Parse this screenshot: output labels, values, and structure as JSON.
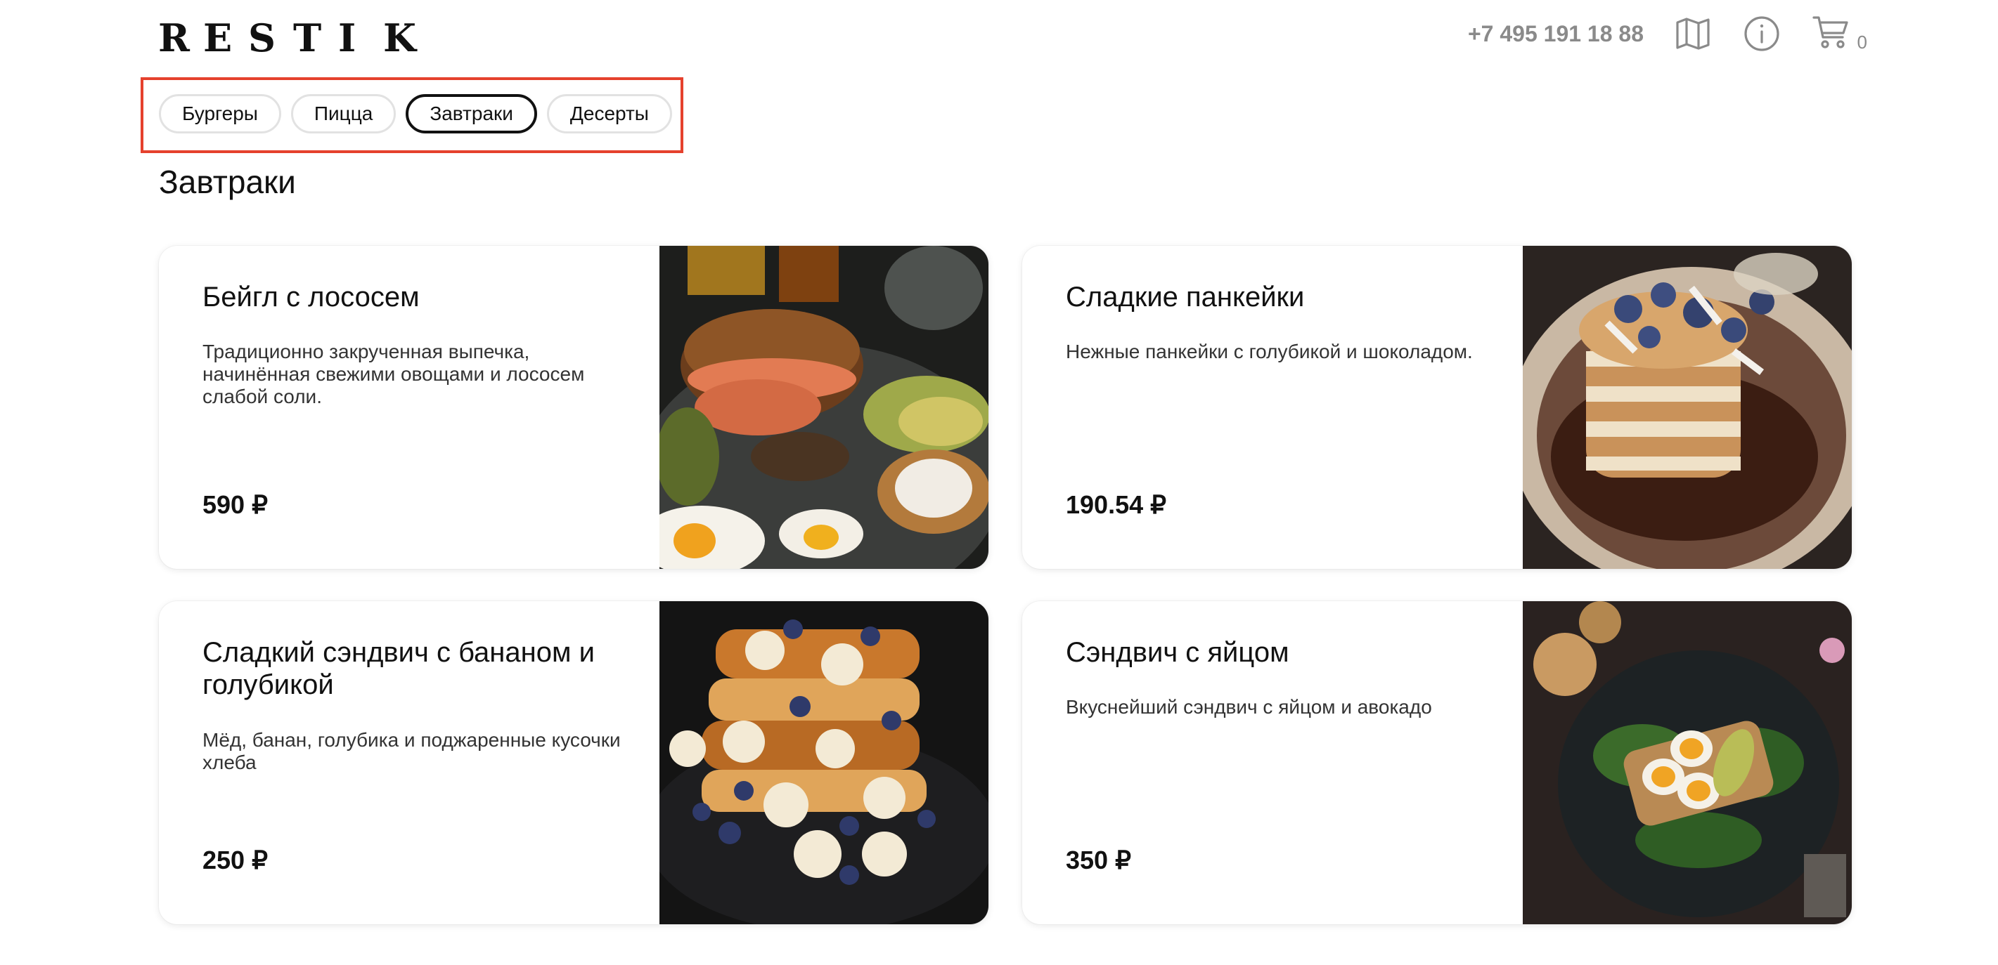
{
  "header": {
    "logo_letters": [
      "R",
      "E",
      "S",
      "T",
      "I",
      "K"
    ],
    "phone": "+7 495 191 18 88",
    "icons": [
      "map-icon",
      "info-icon",
      "cart-icon"
    ],
    "cart_count": "0"
  },
  "categories": {
    "tabs": [
      {
        "label": "Бургеры",
        "active": false
      },
      {
        "label": "Пицца",
        "active": false
      },
      {
        "label": "Завтраки",
        "active": true
      },
      {
        "label": "Десерты",
        "active": false
      }
    ]
  },
  "section": {
    "title": "Завтраки"
  },
  "products": [
    {
      "title": "Бейгл с лососем",
      "description": "Традиционно закрученная выпечка, начинённая свежими овощами и лососем слабой соли.",
      "price": "590 ₽",
      "add_label": "+"
    },
    {
      "title": "Сладкие панкейки",
      "description": "Нежные панкейки с голубикой и шоколадом.",
      "price": "190.54 ₽",
      "add_label": "+"
    },
    {
      "title": "Сладкий сэндвич с бананом и голубикой",
      "description": "Мёд, банан, голубика и поджаренные кусочки хлеба",
      "price": "250 ₽",
      "add_label": "+"
    },
    {
      "title": "Сэндвич с яйцом",
      "description": "Вкуснейший сэндвич с яйцом и авокадо",
      "price": "350 ₽",
      "add_label": "+"
    }
  ],
  "colors": {
    "highlight_border": "#e5412d",
    "active_tab_border": "#111111",
    "muted": "#8a8a8a"
  }
}
